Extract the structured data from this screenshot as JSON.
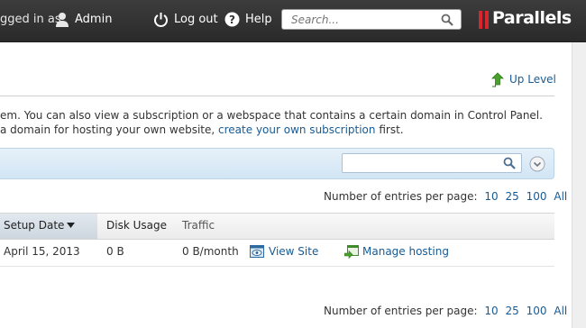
{
  "header": {
    "logged_in_text": "gged in as",
    "user": "Admin",
    "logout": "Log out",
    "help": "Help",
    "search_placeholder": "Search...",
    "logo_text": "Parallels",
    "icons": [
      "user-icon",
      "logout-icon",
      "help-icon",
      "search-icon",
      "parallels-logo-bars"
    ]
  },
  "uplevel": {
    "label": "Up Level",
    "icon": "up-level-arrow-icon"
  },
  "description": {
    "line1": "em. You can also view a subscription or a webspace that contains a certain domain in Control Panel.",
    "line2_prefix": "a domain for hosting your own website,",
    "line2_link": "create your own subscription",
    "line2_suffix": "first."
  },
  "filter": {
    "search_value": "",
    "icons": [
      "search-icon",
      "expand-filter-icon"
    ]
  },
  "pagination": {
    "label": "Number of entries per page:",
    "options": [
      "10",
      "25",
      "100",
      "All"
    ]
  },
  "table": {
    "columns": {
      "setup_date": "Setup Date",
      "disk_usage": "Disk Usage",
      "traffic": "Traffic"
    },
    "sorted_column": "setup_date",
    "sort_direction": "descending",
    "rows": [
      {
        "setup_date": "April 15, 2013",
        "disk_usage": "0 B",
        "traffic": "0 B/month",
        "view_site": "View Site",
        "manage_hosting": "Manage hosting"
      }
    ]
  },
  "colors": {
    "link": "#175b94",
    "topbar": "#333333",
    "filter_bar": "#d9e9f6"
  }
}
